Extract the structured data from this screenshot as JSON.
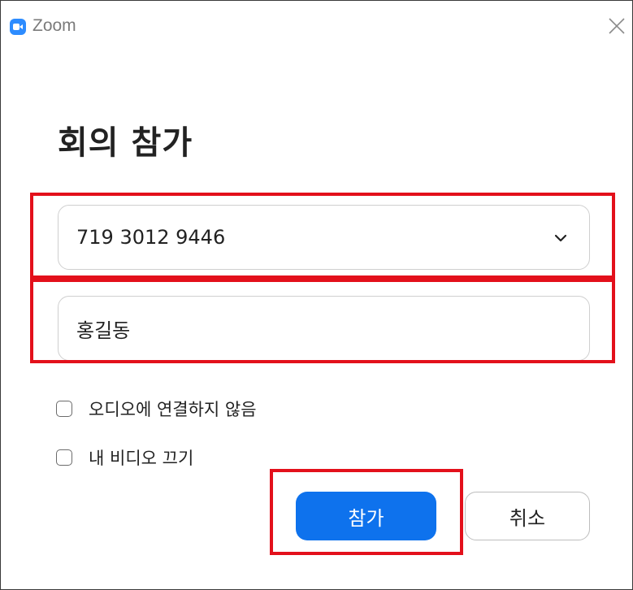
{
  "window": {
    "title": "Zoom",
    "icons": {
      "logo": "zoom-logo-icon",
      "close": "close-icon"
    }
  },
  "dialog": {
    "heading": "회의 참가",
    "meeting_id": {
      "value": "719 3012 9446",
      "icon": "chevron-down-icon"
    },
    "name": {
      "value": "홍길동"
    },
    "options": [
      {
        "label": "오디오에 연결하지 않음",
        "checked": false
      },
      {
        "label": "내 비디오 끄기",
        "checked": false
      }
    ],
    "buttons": {
      "join": "참가",
      "cancel": "취소"
    }
  },
  "colors": {
    "brand_blue": "#2d8cff",
    "join_button": "#0e72ed",
    "highlight_red": "#e3101b"
  }
}
